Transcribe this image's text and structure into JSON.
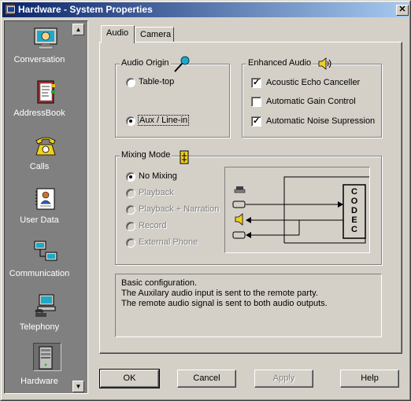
{
  "window": {
    "title": "Hardware - System Properties",
    "close_glyph": "✕"
  },
  "sidebar": {
    "items": [
      {
        "label": "Conversation",
        "icon": "conversation-icon"
      },
      {
        "label": "AddressBook",
        "icon": "addressbook-icon"
      },
      {
        "label": "Calls",
        "icon": "phone-icon"
      },
      {
        "label": "User Data",
        "icon": "user-data-icon"
      },
      {
        "label": "Communication",
        "icon": "network-icon"
      },
      {
        "label": "Telephony",
        "icon": "telephony-icon"
      },
      {
        "label": "Hardware",
        "icon": "hardware-icon",
        "selected": true
      }
    ],
    "scroll_up": "▲",
    "scroll_down": "▼"
  },
  "tabs": [
    {
      "label": "Audio",
      "active": true
    },
    {
      "label": "Camera",
      "active": false
    }
  ],
  "audio_origin": {
    "title": "Audio Origin",
    "options": [
      {
        "label": "Table-top",
        "selected": false
      },
      {
        "label": "Aux / Line-in",
        "selected": true
      }
    ]
  },
  "enhanced_audio": {
    "title": "Enhanced Audio",
    "options": [
      {
        "label": "Acoustic Echo Canceller",
        "checked": true
      },
      {
        "label": "Automatic Gain Control",
        "checked": false
      },
      {
        "label": "Automatic Noise Supression",
        "checked": true
      }
    ]
  },
  "mixing_mode": {
    "title": "Mixing Mode",
    "options": [
      {
        "label": "No Mixing",
        "selected": true,
        "enabled": true
      },
      {
        "label": "Playback",
        "selected": false,
        "enabled": false
      },
      {
        "label": "Playback + Narration",
        "selected": false,
        "enabled": false
      },
      {
        "label": "Record",
        "selected": false,
        "enabled": false
      },
      {
        "label": "External Phone",
        "selected": false,
        "enabled": false
      }
    ],
    "codec_letters": [
      "C",
      "O",
      "D",
      "E",
      "C"
    ]
  },
  "info": {
    "lines": [
      "Basic configuration.",
      "The Auxilary audio input is sent to the remote party.",
      "The remote audio signal is sent to both audio outputs."
    ]
  },
  "buttons": {
    "ok": "OK",
    "cancel": "Cancel",
    "apply": "Apply",
    "help": "Help"
  }
}
